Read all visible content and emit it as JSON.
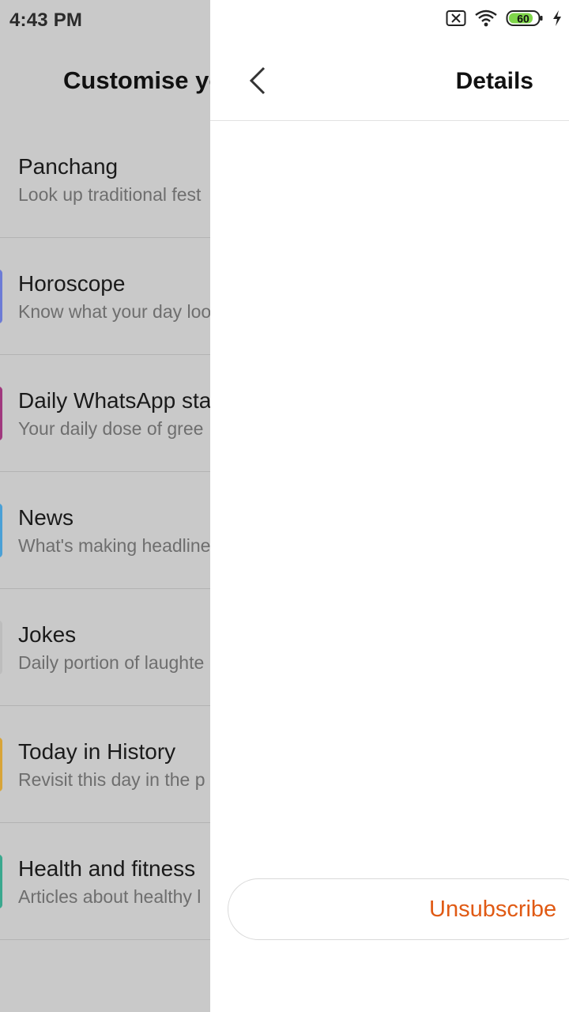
{
  "status_bar": {
    "time": "4:43 PM",
    "battery": "60"
  },
  "background_screen": {
    "title": "Customise yo",
    "items": [
      {
        "title": "Panchang",
        "subtitle": "Look up traditional fest",
        "accent": ""
      },
      {
        "title": "Horoscope",
        "subtitle": "Know what your day loo",
        "accent": "#6c7bd6"
      },
      {
        "title": "Daily WhatsApp stat",
        "subtitle": "Your daily dose of gree",
        "accent": "#a0387e"
      },
      {
        "title": "News",
        "subtitle": "What's making headline",
        "accent": "#4aa0d6"
      },
      {
        "title": "Jokes",
        "subtitle": "Daily portion of laughte",
        "accent": "#bdbdbd"
      },
      {
        "title": "Today in History",
        "subtitle": "Revisit this day in the p",
        "accent": "#d8a438"
      },
      {
        "title": "Health and fitness",
        "subtitle": "Articles about healthy l",
        "accent": "#3aa88e"
      }
    ]
  },
  "details_panel": {
    "title": "Details",
    "unsubscribe_label": "Unsubscribe",
    "accent_color": "#e05a14"
  }
}
